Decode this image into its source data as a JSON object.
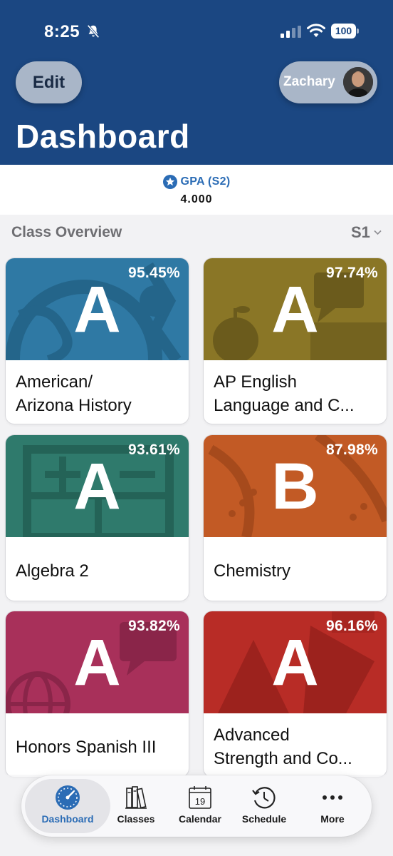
{
  "status_bar": {
    "time": "8:25",
    "battery": "100",
    "icons": [
      "bell-slash-icon",
      "signal-icon",
      "wifi-icon",
      "battery-icon"
    ]
  },
  "header": {
    "edit_label": "Edit",
    "user_name": "Zachary",
    "title": "Dashboard",
    "background_color": "#1b4782"
  },
  "gpa": {
    "label": "GPA (S2)",
    "value": "4.000",
    "icon": "star-icon"
  },
  "overview": {
    "title": "Class Overview",
    "term": "S1"
  },
  "classes": [
    {
      "name": "American/ Arizona History",
      "name_lines": [
        "American/",
        "Arizona History"
      ],
      "percent": "95.45%",
      "grade": "A",
      "color": "#2f79a4"
    },
    {
      "name": "AP English Language and C...",
      "name_lines": [
        "AP English",
        "Language and C..."
      ],
      "percent": "97.74%",
      "grade": "A",
      "color": "#8a7626"
    },
    {
      "name": "Algebra 2",
      "name_lines": [
        "Algebra 2",
        ""
      ],
      "percent": "93.61%",
      "grade": "A",
      "color": "#2f7a6c"
    },
    {
      "name": "Chemistry",
      "name_lines": [
        "Chemistry",
        ""
      ],
      "percent": "87.98%",
      "grade": "B",
      "color": "#c25a25"
    },
    {
      "name": "Honors Spanish III",
      "name_lines": [
        "Honors Spanish III",
        ""
      ],
      "percent": "93.82%",
      "grade": "A",
      "color": "#a8305a"
    },
    {
      "name": "Advanced Strength and Co...",
      "name_lines": [
        "Advanced",
        "Strength and Co..."
      ],
      "percent": "96.16%",
      "grade": "A",
      "color": "#b82c26"
    }
  ],
  "tabs": [
    {
      "label": "Dashboard",
      "icon": "gauge-icon",
      "active": true
    },
    {
      "label": "Classes",
      "icon": "books-icon",
      "active": false
    },
    {
      "label": "Calendar",
      "icon": "calendar-icon",
      "active": false
    },
    {
      "label": "Schedule",
      "icon": "clock-history-icon",
      "active": false
    },
    {
      "label": "More",
      "icon": "ellipsis-icon",
      "active": false
    }
  ],
  "calendar_icon_day": "19",
  "accent_color": "#2b6cb5"
}
